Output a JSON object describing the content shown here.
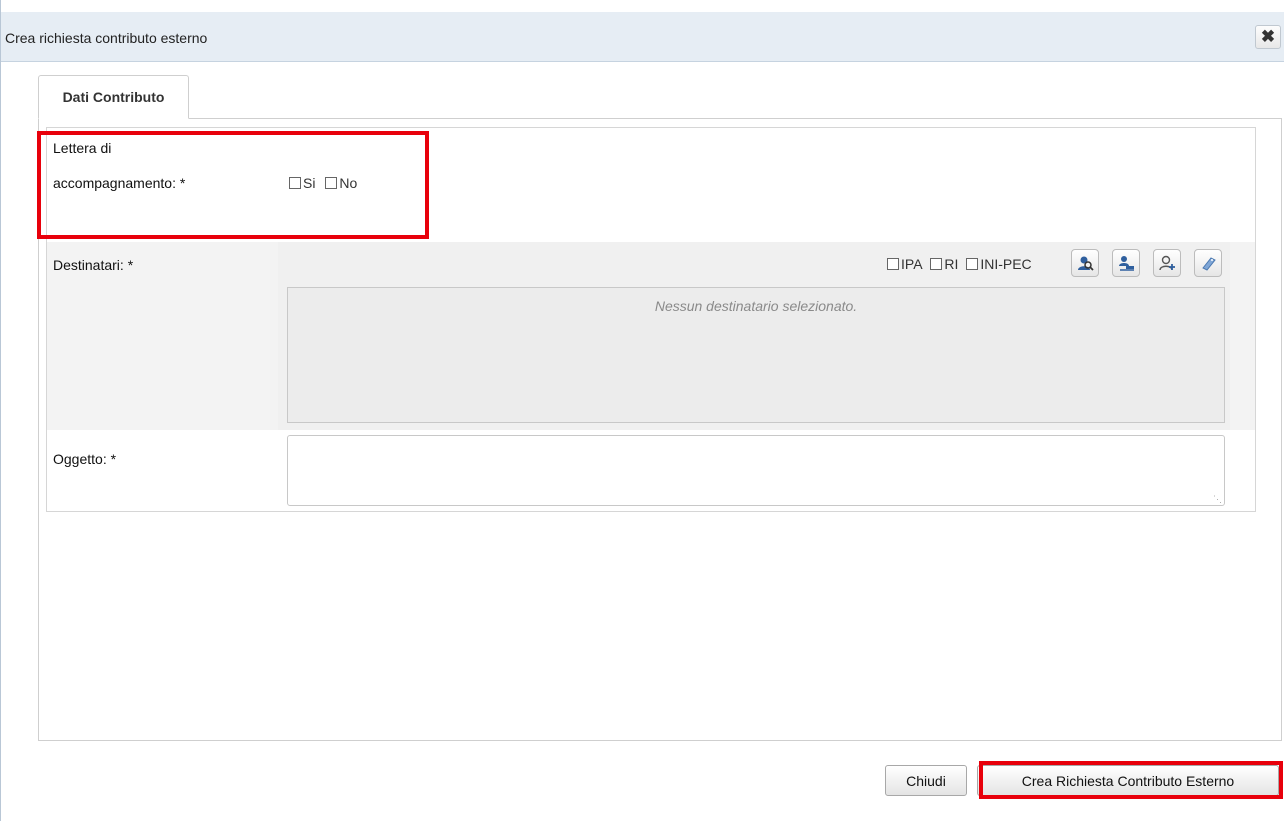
{
  "dialog": {
    "title": "Crea richiesta contributo esterno",
    "close_icon": "close-icon"
  },
  "tabs": [
    {
      "label": "Dati Contributo",
      "active": true
    }
  ],
  "form": {
    "lettera": {
      "label_line1": "Lettera di",
      "label_line2": "accompagnamento: *",
      "options": [
        {
          "label": "Si",
          "checked": false
        },
        {
          "label": "No",
          "checked": false
        }
      ]
    },
    "destinatari": {
      "label": "Destinatari: *",
      "filters": [
        {
          "label": "IPA",
          "checked": false
        },
        {
          "label": "RI",
          "checked": false
        },
        {
          "label": "INI-PEC",
          "checked": false
        }
      ],
      "action_icons": [
        "search-recipient-icon",
        "recipient-group-icon",
        "add-recipient-icon",
        "tag-icon"
      ],
      "empty_text": "Nessun destinatario selezionato."
    },
    "oggetto": {
      "label": "Oggetto: *",
      "value": ""
    }
  },
  "footer": {
    "close_label": "Chiudi",
    "submit_label": "Crea Richiesta Contributo Esterno"
  },
  "colors": {
    "highlight": "#e8000b",
    "titlebar_bg": "#e6edf4"
  }
}
